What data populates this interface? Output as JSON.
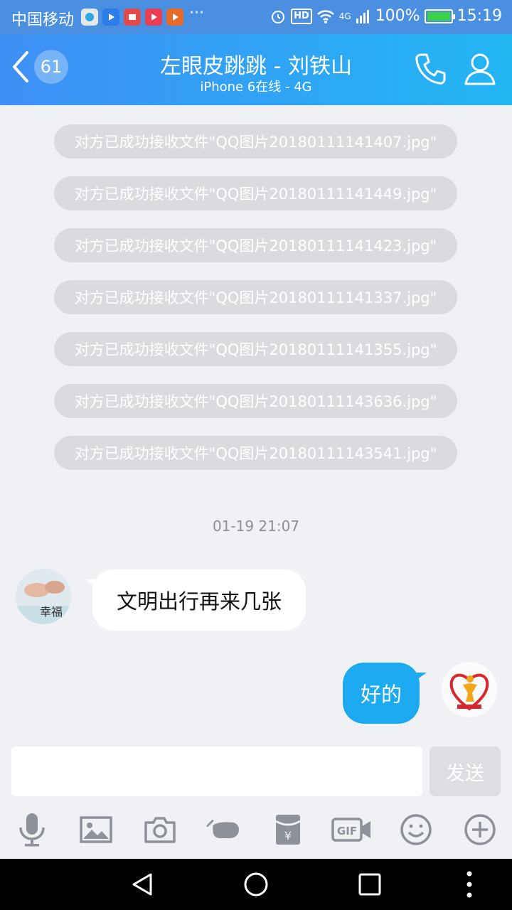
{
  "status_bar": {
    "carrier": "中国移动",
    "more": "···",
    "network": "4G",
    "hd": "HD",
    "battery_text": "100%",
    "time": "15:19"
  },
  "header": {
    "unread_count": "61",
    "title": "左眼皮跳跳 - 刘铁山",
    "subtitle": "iPhone 6在线 - 4G"
  },
  "messages": {
    "system": [
      "对方已成功接收文件\"QQ图片20180111141407.jpg\"",
      "对方已成功接收文件\"QQ图片20180111141449.jpg\"",
      "对方已成功接收文件\"QQ图片20180111141423.jpg\"",
      "对方已成功接收文件\"QQ图片20180111141337.jpg\"",
      "对方已成功接收文件\"QQ图片20180111141355.jpg\"",
      "对方已成功接收文件\"QQ图片20180111143636.jpg\"",
      "对方已成功接收文件\"QQ图片20180111143541.jpg\""
    ],
    "timestamp": "01-19 21:07",
    "incoming_text": "文明出行再来几张",
    "outgoing_text": "好的"
  },
  "input": {
    "placeholder": "",
    "send_label": "发送"
  },
  "toolbar": {
    "gif_label": "GIF",
    "icons": [
      "microphone-icon",
      "image-icon",
      "camera-icon",
      "poke-icon",
      "red-packet-icon",
      "gif-icon",
      "emoji-icon",
      "plus-icon"
    ]
  },
  "colors": {
    "header_start": "#3f8ff5",
    "header_end": "#22b6f3",
    "outgoing_bubble": "#1eaaf1",
    "system_bubble": "#dadbde",
    "background": "#f0f1f5"
  }
}
